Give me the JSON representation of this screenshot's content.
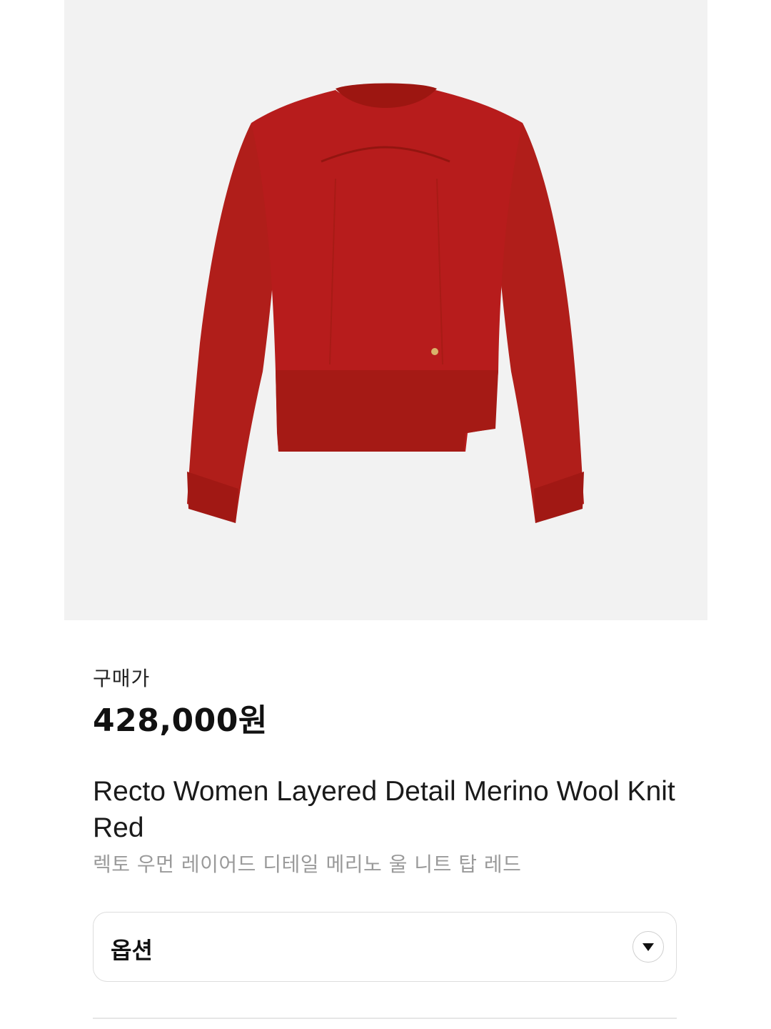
{
  "product": {
    "image_icon": "sweater-photo",
    "price_label": "구매가",
    "price": "428,000원",
    "name_en": "Recto Women Layered Detail Merino Wool Knit Red",
    "name_kr": "렉토 우먼 레이어드 디테일 메리노 울 니트 탑 레드"
  },
  "option": {
    "label": "옵션",
    "icon": "chevron-down-icon"
  },
  "colors": {
    "image_bg": "#f2f2f2",
    "sweater": "#b71c1c",
    "text_primary": "#111111",
    "text_secondary": "#9a9a9a",
    "border": "#dddddd"
  }
}
